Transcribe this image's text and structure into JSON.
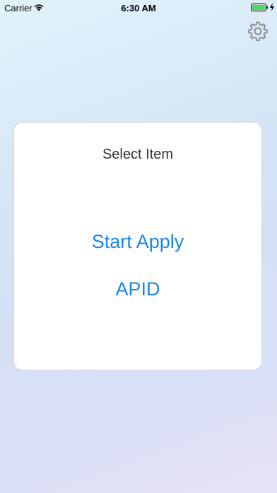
{
  "status_bar": {
    "carrier": "Carrier",
    "time": "6:30 AM",
    "battery_color": "#4cd964",
    "icons": [
      "wifi-icon",
      "battery-icon",
      "charge-icon"
    ]
  },
  "settings": {
    "icon": "gear-icon",
    "color": "#8e8e93"
  },
  "card": {
    "title": "Select Item",
    "buttons": [
      {
        "label": "Start Apply"
      },
      {
        "label": "APID"
      }
    ],
    "accent_color": "#1a86e8"
  }
}
